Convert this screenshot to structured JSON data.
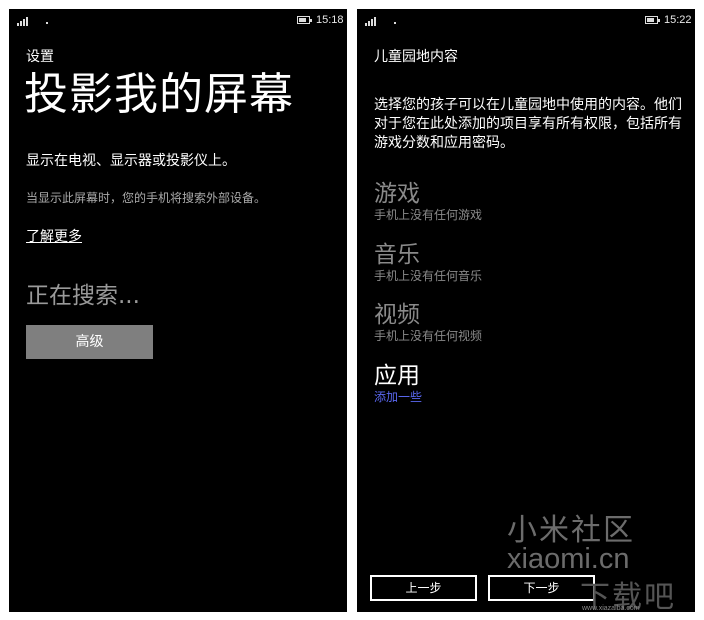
{
  "left_phone": {
    "status": {
      "time": "15:18"
    },
    "app_title": "设置",
    "page_title": "投影我的屏幕",
    "description": "显示在电视、显示器或投影仪上。",
    "hint": "当显示此屏幕时，您的手机将搜索外部设备。",
    "learn_more": "了解更多",
    "searching": "正在搜索...",
    "advanced_button": "高级"
  },
  "right_phone": {
    "status": {
      "time": "15:22"
    },
    "app_title": "儿童园地内容",
    "description": "选择您的孩子可以在儿童园地中使用的内容。他们对于您在此处添加的项目享有所有权限，包括所有游戏分数和应用密码。",
    "categories": [
      {
        "title": "游戏",
        "subtitle": "手机上没有任何游戏"
      },
      {
        "title": "音乐",
        "subtitle": "手机上没有任何音乐"
      },
      {
        "title": "视频",
        "subtitle": "手机上没有任何视频"
      },
      {
        "title": "应用",
        "link": "添加一些"
      }
    ],
    "prev_button": "上一步",
    "next_button": "下一步"
  },
  "watermark": {
    "line1": "小米社区",
    "line2": "xiaomi.cn",
    "corner_logo": "下载吧",
    "corner_url": "www.xiazaiba.com"
  },
  "colors": {
    "background": "#000000",
    "button_gray": "#7f7f7f",
    "muted_text": "#8a8a8a",
    "link_blue": "#5a67f0"
  },
  "icons": [
    "signal-icon",
    "battery-icon"
  ]
}
